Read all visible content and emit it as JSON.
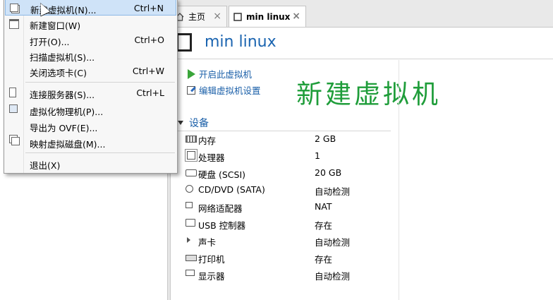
{
  "tabs": [
    {
      "label": "主页",
      "icon": "home-icon"
    },
    {
      "label": "min linux",
      "icon": "vm-icon"
    }
  ],
  "vm": {
    "title": "min linux",
    "actions": [
      {
        "label": "开启此虚拟机",
        "icon": "play-icon"
      },
      {
        "label": "编辑虚拟机设置",
        "icon": "edit-settings-icon"
      }
    ]
  },
  "annotation": "新建虚拟机",
  "devices": {
    "title": "设备",
    "items": [
      {
        "name": "内存",
        "value": "2 GB",
        "icon": "memory-icon"
      },
      {
        "name": "处理器",
        "value": "1",
        "icon": "processor-icon"
      },
      {
        "name": "硬盘 (SCSI)",
        "value": "20 GB",
        "icon": "harddisk-icon"
      },
      {
        "name": "CD/DVD (SATA)",
        "value": "自动检测",
        "icon": "cd-dvd-icon"
      },
      {
        "name": "网络适配器",
        "value": "NAT",
        "icon": "network-adapter-icon"
      },
      {
        "name": "USB 控制器",
        "value": "存在",
        "icon": "usb-icon"
      },
      {
        "name": "声卡",
        "value": "自动检测",
        "icon": "sound-card-icon"
      },
      {
        "name": "打印机",
        "value": "存在",
        "icon": "printer-icon"
      },
      {
        "name": "显示器",
        "value": "自动检测",
        "icon": "display-icon"
      }
    ]
  },
  "menu": {
    "items": [
      {
        "label": "新建虚拟机(N)...",
        "shortcut": "Ctrl+N",
        "icon": "new-vm-icon",
        "highlighted": true
      },
      {
        "label": "新建窗口(W)",
        "shortcut": "",
        "icon": "new-window-icon"
      },
      {
        "label": "打开(O)...",
        "shortcut": "Ctrl+O",
        "icon": ""
      },
      {
        "label": "扫描虚拟机(S)...",
        "shortcut": "",
        "icon": ""
      },
      {
        "label": "关闭选项卡(C)",
        "shortcut": "Ctrl+W",
        "icon": ""
      },
      {
        "label": "连接服务器(S)...",
        "shortcut": "Ctrl+L",
        "icon": "connect-server-icon"
      },
      {
        "label": "虚拟化物理机(P)...",
        "shortcut": "",
        "icon": "virtualize-physical-icon"
      },
      {
        "label": "导出为 OVF(E)...",
        "shortcut": "",
        "icon": ""
      },
      {
        "label": "映射虚拟磁盘(M)...",
        "shortcut": "",
        "icon": "map-disk-icon"
      },
      {
        "label": "退出(X)",
        "shortcut": "",
        "icon": ""
      }
    ]
  },
  "colors": {
    "link": "#1a5fa8",
    "annotation": "#1f9d3a",
    "title": "#1a64b0",
    "menu_highlight": "#cfe3f8"
  }
}
